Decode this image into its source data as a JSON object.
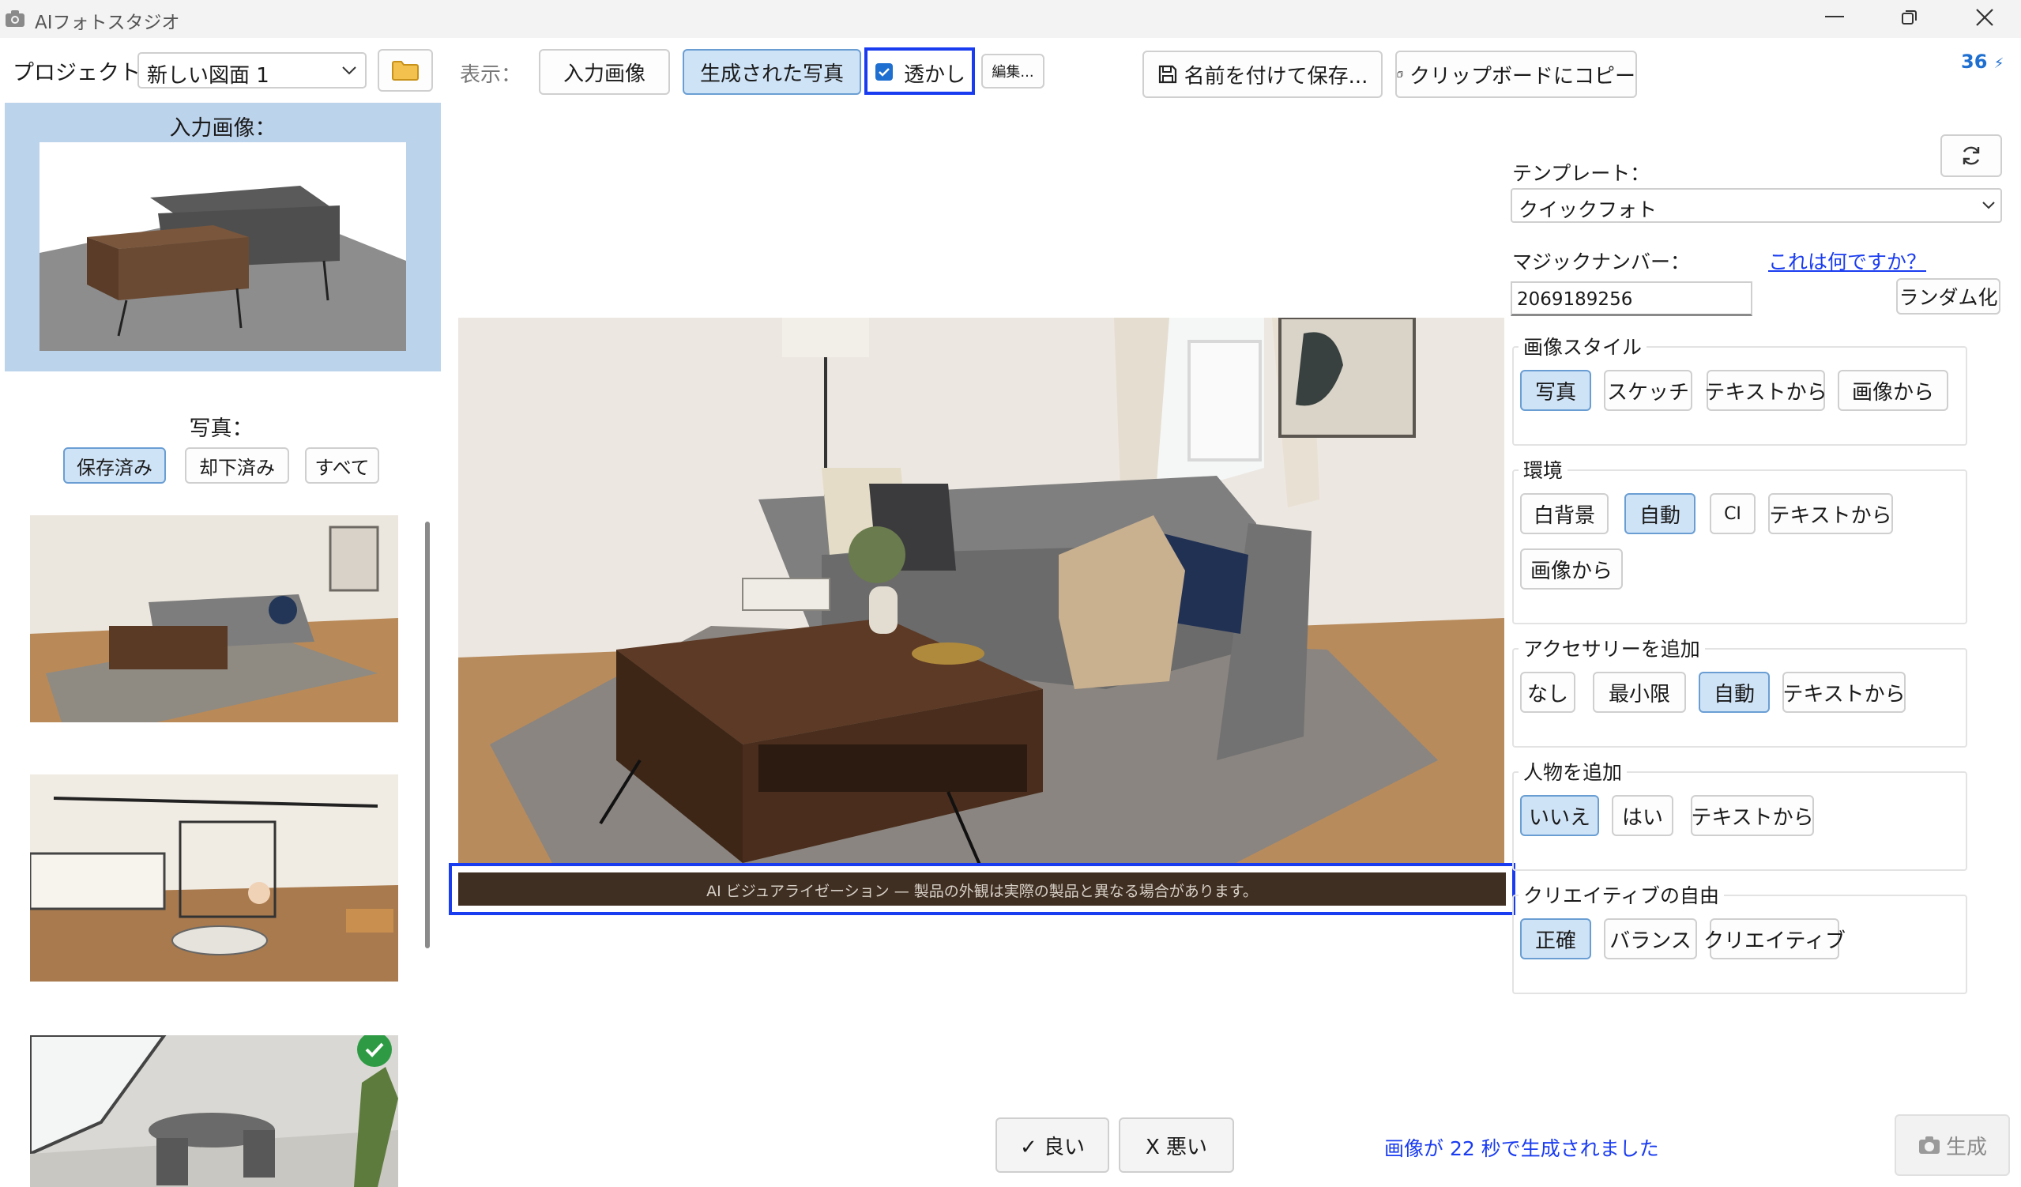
{
  "window": {
    "title": "AIフォトスタジオ"
  },
  "toolbar": {
    "project_label": "プロジェクト：",
    "project_value": "新しい図面 1",
    "view_label": "表示：",
    "input_image_button": "入力画像",
    "generated_photo_button": "生成された写真",
    "watermark_label": "透かし",
    "edit_button": "編集...",
    "save_as_button": "名前を付けて保存...",
    "copy_clipboard_button": "クリップボードにコピー",
    "credits": "36"
  },
  "left_panel": {
    "input_image_title": "入力画像：",
    "photos_title": "写真：",
    "filters": [
      "保存済み",
      "却下済み",
      "すべて"
    ],
    "selected_filter": "保存済み"
  },
  "preview": {
    "watermark_text": "AI ビジュアライゼーション — 製品の外観は実際の製品と異なる場合があります。"
  },
  "settings": {
    "template_label": "テンプレート：",
    "template_value": "クイックフォト",
    "magic_number_label": "マジックナンバー：",
    "what_is_this_link": "これは何ですか？",
    "magic_number_value": "2069189256",
    "randomize_button": "ランダム化",
    "image_style": {
      "title": "画像スタイル",
      "options": [
        "写真",
        "スケッチ",
        "テキストから",
        "画像から"
      ],
      "selected": "写真"
    },
    "environment": {
      "title": "環境",
      "options": [
        "白背景",
        "自動",
        "CI",
        "テキストから",
        "画像から"
      ],
      "selected": "自動"
    },
    "accessories": {
      "title": "アクセサリーを追加",
      "options": [
        "なし",
        "最小限",
        "自動",
        "テキストから"
      ],
      "selected": "自動"
    },
    "people": {
      "title": "人物を追加",
      "options": [
        "いいえ",
        "はい",
        "テキストから"
      ],
      "selected": "いいえ"
    },
    "creative_freedom": {
      "title": "クリエイティブの自由",
      "options": [
        "正確",
        "バランス",
        "クリエイティブ"
      ],
      "selected": "正確"
    }
  },
  "footer": {
    "good_button": "✓ 良い",
    "bad_button": "X 悪い",
    "status_text": "画像が 22 秒で生成されました",
    "generate_button": "生成"
  },
  "colors": {
    "accent": "#1a3cf0",
    "selected_bg": "#cfe3f7",
    "link": "#1a3cf0"
  }
}
